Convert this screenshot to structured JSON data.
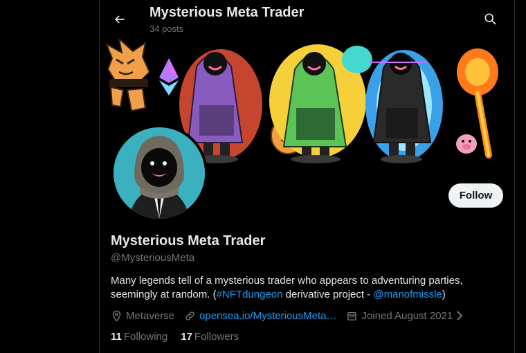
{
  "header": {
    "title": "Mysterious Meta Trader",
    "post_count": "34 posts",
    "icons": {
      "back": "arrow-left-icon",
      "search": "search-icon"
    }
  },
  "banner": {
    "description_items": [
      "fox-creature-art",
      "ethereum-diamond-art",
      "purple-hooded-trader-art",
      "green-hooded-trader-art",
      "blue-hooded-trader-art",
      "orange-blob-art",
      "pink-pig-art",
      "flaming-axe-art"
    ]
  },
  "profile": {
    "name": "Mysterious Meta Trader",
    "handle": "@MysteriousMeta",
    "follow_label": "Follow",
    "bio_part1": "Many legends tell of a mysterious trader who appears to adventuring parties, seemingly at random. (",
    "bio_hashtag": "#NFTdungeon",
    "bio_part2": " derivative project - ",
    "bio_mention": "@manofmissle",
    "bio_part3": ")",
    "location": "Metaverse",
    "website": "opensea.io/MysteriousMeta…",
    "joined": "Joined August 2021",
    "following_count": "11",
    "following_label": "Following",
    "followers_count": "17",
    "followers_label": "Followers"
  },
  "colors": {
    "background": "#000000",
    "text": "#e7e9ea",
    "muted": "#71767b",
    "link": "#1d9bf0",
    "follow_bg": "#eff3f4",
    "border": "#2f3336",
    "avatar_bg": "#3bb0bf"
  }
}
